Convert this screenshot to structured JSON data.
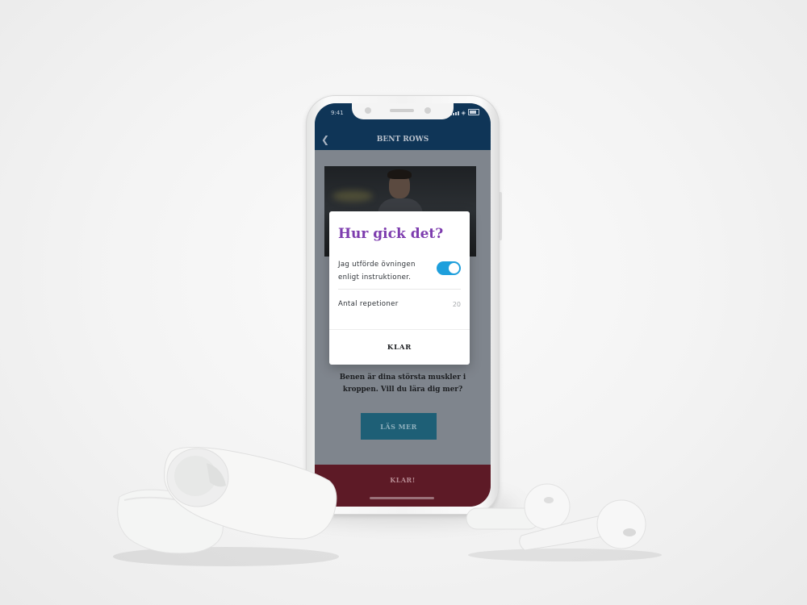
{
  "status_bar": {
    "time": "9:41"
  },
  "header": {
    "title": "BENT ROWS",
    "back_icon": "chevron-left-icon"
  },
  "dialog": {
    "title": "Hur gick det?",
    "toggle_label": "Jag utförde övningen enligt instruktioner.",
    "toggle_on": true,
    "reps_label": "Antal repetioner",
    "reps_value": "20",
    "ok_label": "KLAR"
  },
  "body": {
    "info_text": "Benen är dina största muskler i kroppen. Vill du lära dig mer?",
    "read_more_label": "LÄS MER"
  },
  "footer": {
    "done_label": "KLAR!"
  },
  "colors": {
    "header_bg": "#0f3557",
    "dialog_title": "#7d3cae",
    "toggle": "#1e9fdc",
    "read_more_bg": "#1e5f76",
    "done_bar_bg": "#5d1a26"
  }
}
